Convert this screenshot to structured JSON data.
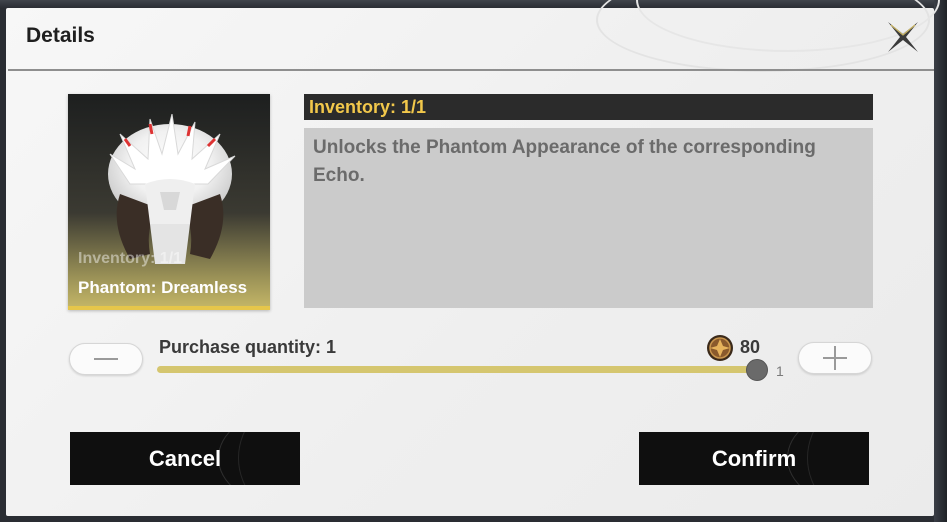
{
  "dialog": {
    "title": "Details",
    "close_icon": "close-x-icon"
  },
  "item": {
    "card_inventory": "Inventory: 1/1",
    "name": "Phantom: Dreamless",
    "portrait_icon": "phantom-dreamless-portrait"
  },
  "info": {
    "inventory": "Inventory: 1/1",
    "description": "Unlocks the Phantom Appearance of the corresponding Echo."
  },
  "purchase": {
    "quantity_label": "Purchase quantity: 1",
    "price": "80",
    "max": "1",
    "quantity_fraction": 1.0,
    "currency_icon": "coin-icon",
    "decrease_icon": "minus-icon",
    "increase_icon": "plus-icon"
  },
  "buttons": {
    "cancel": "Cancel",
    "confirm": "Confirm"
  },
  "colors": {
    "accent_gold": "#f2c84b",
    "slider_fill": "#d5c66f",
    "button_dark": "#0f0f0f"
  }
}
